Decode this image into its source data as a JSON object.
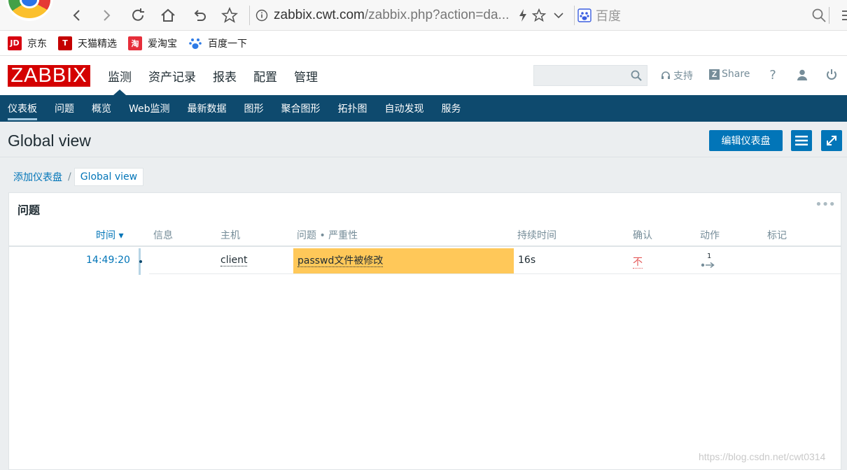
{
  "browser": {
    "url_host": "zabbix.cwt.com",
    "url_path": "/zabbix.php?action=da...",
    "search_engine": "百度"
  },
  "bookmarks": [
    {
      "label": "京东",
      "icon": "jd-icon",
      "badge": "JD",
      "color": "#d7000f"
    },
    {
      "label": "天猫精选",
      "icon": "tmall-icon",
      "badge": "T",
      "color": "#c40000"
    },
    {
      "label": "爱淘宝",
      "icon": "taobao-icon",
      "badge": "淘",
      "color": "#e62e3a"
    },
    {
      "label": "百度一下",
      "icon": "baidu-paw-icon",
      "badge": "",
      "color": "#2e7be6"
    }
  ],
  "header": {
    "logo": "ZABBIX",
    "menu": [
      "监测",
      "资产记录",
      "报表",
      "配置",
      "管理"
    ],
    "search_placeholder": "",
    "support": "支持",
    "share": "Share",
    "help": "?"
  },
  "subnav": [
    "仪表板",
    "问题",
    "概览",
    "Web监测",
    "最新数据",
    "图形",
    "聚合图形",
    "拓扑图",
    "自动发现",
    "服务"
  ],
  "page": {
    "title": "Global view",
    "edit_button": "编辑仪表盘"
  },
  "breadcrumb": {
    "parent": "添加仪表盘",
    "separator": "/",
    "current": "Global view"
  },
  "widget": {
    "title": "问题",
    "columns": {
      "time": "时间 ▾",
      "info": "信息",
      "host": "主机",
      "problem": "问题 • 严重性",
      "duration": "持续时间",
      "ack": "确认",
      "actions": "动作",
      "tags": "标记"
    },
    "rows": [
      {
        "time": "14:49:20",
        "info": "",
        "host": "client",
        "problem": "passwd文件被修改",
        "duration": "16s",
        "ack": "不",
        "actions_count": "1",
        "tags": ""
      }
    ],
    "severity_color": "#ffc859"
  },
  "watermark": "https://blog.csdn.net/cwt0314"
}
